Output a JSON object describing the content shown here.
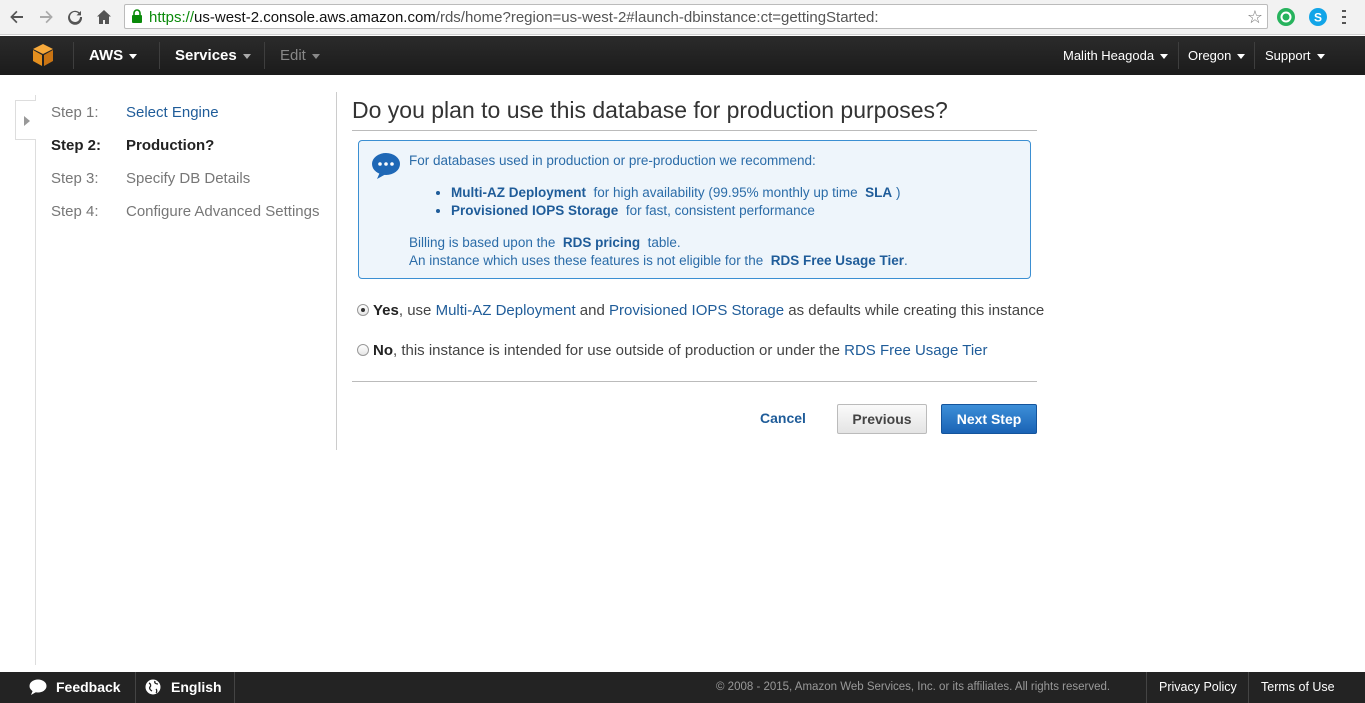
{
  "browser": {
    "url_scheme": "https://",
    "url_host": "us-west-2.console.aws.amazon.com",
    "url_path": "/rds/home?region=us-west-2#launch-dbinstance:ct=gettingStarted:"
  },
  "nav": {
    "aws_label": "AWS",
    "services_label": "Services",
    "edit_label": "Edit",
    "user_label": "Malith Heagoda",
    "region_label": "Oregon",
    "support_label": "Support"
  },
  "steps": [
    {
      "num": "Step 1:",
      "label": "Select Engine"
    },
    {
      "num": "Step 2:",
      "label": "Production?"
    },
    {
      "num": "Step 3:",
      "label": "Specify DB Details"
    },
    {
      "num": "Step 4:",
      "label": "Configure Advanced Settings"
    }
  ],
  "main": {
    "title": "Do you plan to use this database for production purposes?",
    "info": {
      "intro": "For databases used in production or pre-production we recommend:",
      "b1_strong": "Multi-AZ Deployment",
      "b1_text": "for high availability (99.95% monthly up time",
      "b1_sla": "SLA",
      "b1_close": ")",
      "b2_strong": "Provisioned IOPS Storage",
      "b2_text": "for fast, consistent performance",
      "billing_pre": "Billing is based upon the",
      "billing_link": "RDS pricing",
      "billing_post": "table.",
      "instance_pre": "An instance which uses these features is not eligible for the",
      "instance_link": "RDS Free Usage Tier",
      "instance_post": "."
    },
    "yes_option": {
      "strong": "Yes",
      "pre": ", use",
      "link1": "Multi-AZ Deployment",
      "mid": "and",
      "link2": "Provisioned IOPS Storage",
      "post": "as defaults while creating this instance",
      "checked": true
    },
    "no_option": {
      "strong": "No",
      "pre": ", this instance is intended for use outside of production or under the",
      "link": "RDS Free Usage Tier",
      "checked": false
    },
    "cancel_label": "Cancel",
    "previous_label": "Previous",
    "next_label": "Next Step"
  },
  "footer": {
    "feedback_label": "Feedback",
    "language_label": "English",
    "copyright": "© 2008 - 2015, Amazon Web Services, Inc. or its affiliates. All rights reserved.",
    "privacy_label": "Privacy Policy",
    "terms_label": "Terms of Use"
  },
  "colors": {
    "link": "#1f5c99",
    "primary_button": "#1a63b5",
    "nav_bg": "#232323",
    "info_border": "#3b8fd2"
  }
}
